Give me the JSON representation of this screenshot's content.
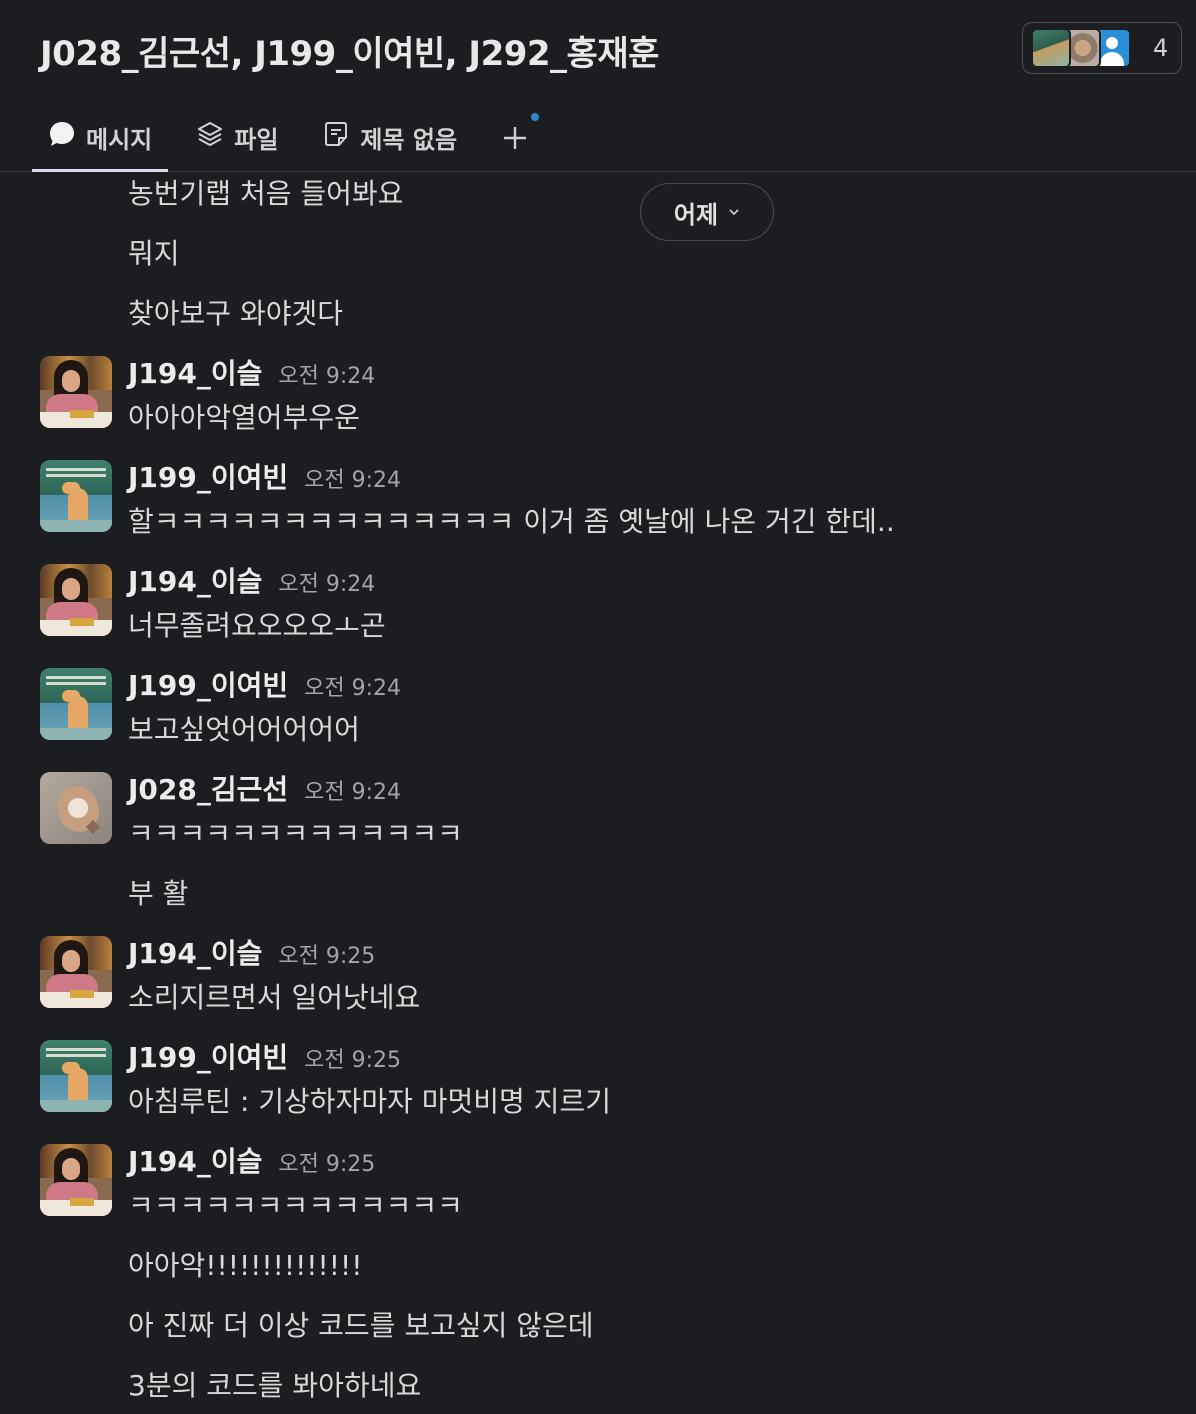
{
  "header": {
    "title": "J028_김근선, J199_이여빈, J292_홍재훈",
    "member_count": "4"
  },
  "tabs": [
    {
      "label": "메시지",
      "icon": "message-bubble-icon",
      "active": true
    },
    {
      "label": "파일",
      "icon": "layers-icon",
      "active": false
    },
    {
      "label": "제목 없음",
      "icon": "canvas-note-icon",
      "active": false
    }
  ],
  "date_divider": {
    "label": "어제"
  },
  "colors": {
    "background": "#1b1d21",
    "active_tab_underline": "#e2d7f0",
    "notification_dot": "#2f87c8"
  },
  "messages": [
    {
      "text": "농번기랩 처음 들어봐요"
    },
    {
      "text": "뭐지"
    },
    {
      "text": "찾아보구 와야겟다"
    },
    {
      "author": "J194_이슬",
      "time": "오전 9:24",
      "text": "아아아악열어부우운"
    },
    {
      "author": "J199_이여빈",
      "time": "오전 9:24",
      "text": "할ㅋㅋㅋㅋㅋㅋㅋㅋㅋㅋㅋㅋㅋㅋ 이거 좀 옛날에 나온 거긴 한데.."
    },
    {
      "author": "J194_이슬",
      "time": "오전 9:24",
      "text": "너무졸려요오오오ㅗ곤"
    },
    {
      "author": "J199_이여빈",
      "time": "오전 9:24",
      "text": "보고싶엇어어어어어"
    },
    {
      "author": "J028_김근선",
      "time": "오전 9:24",
      "text": "ㅋㅋㅋㅋㅋㅋㅋㅋㅋㅋㅋㅋㅋ"
    },
    {
      "text": "부 활"
    },
    {
      "author": "J194_이슬",
      "time": "오전 9:25",
      "text": "소리지르면서 일어낫네요"
    },
    {
      "author": "J199_이여빈",
      "time": "오전 9:25",
      "text": "아침루틴 : 기상하자마자 마멋비명 지르기"
    },
    {
      "author": "J194_이슬",
      "time": "오전 9:25",
      "text": "ㅋㅋㅋㅋㅋㅋㅋㅋㅋㅋㅋㅋㅋ"
    },
    {
      "text": "아아악!!!!!!!!!!!!!!"
    },
    {
      "text": "아 진짜 더 이상 코드를 보고싶지 않은데"
    },
    {
      "text": "3분의 코드를 봐아하네요"
    }
  ]
}
